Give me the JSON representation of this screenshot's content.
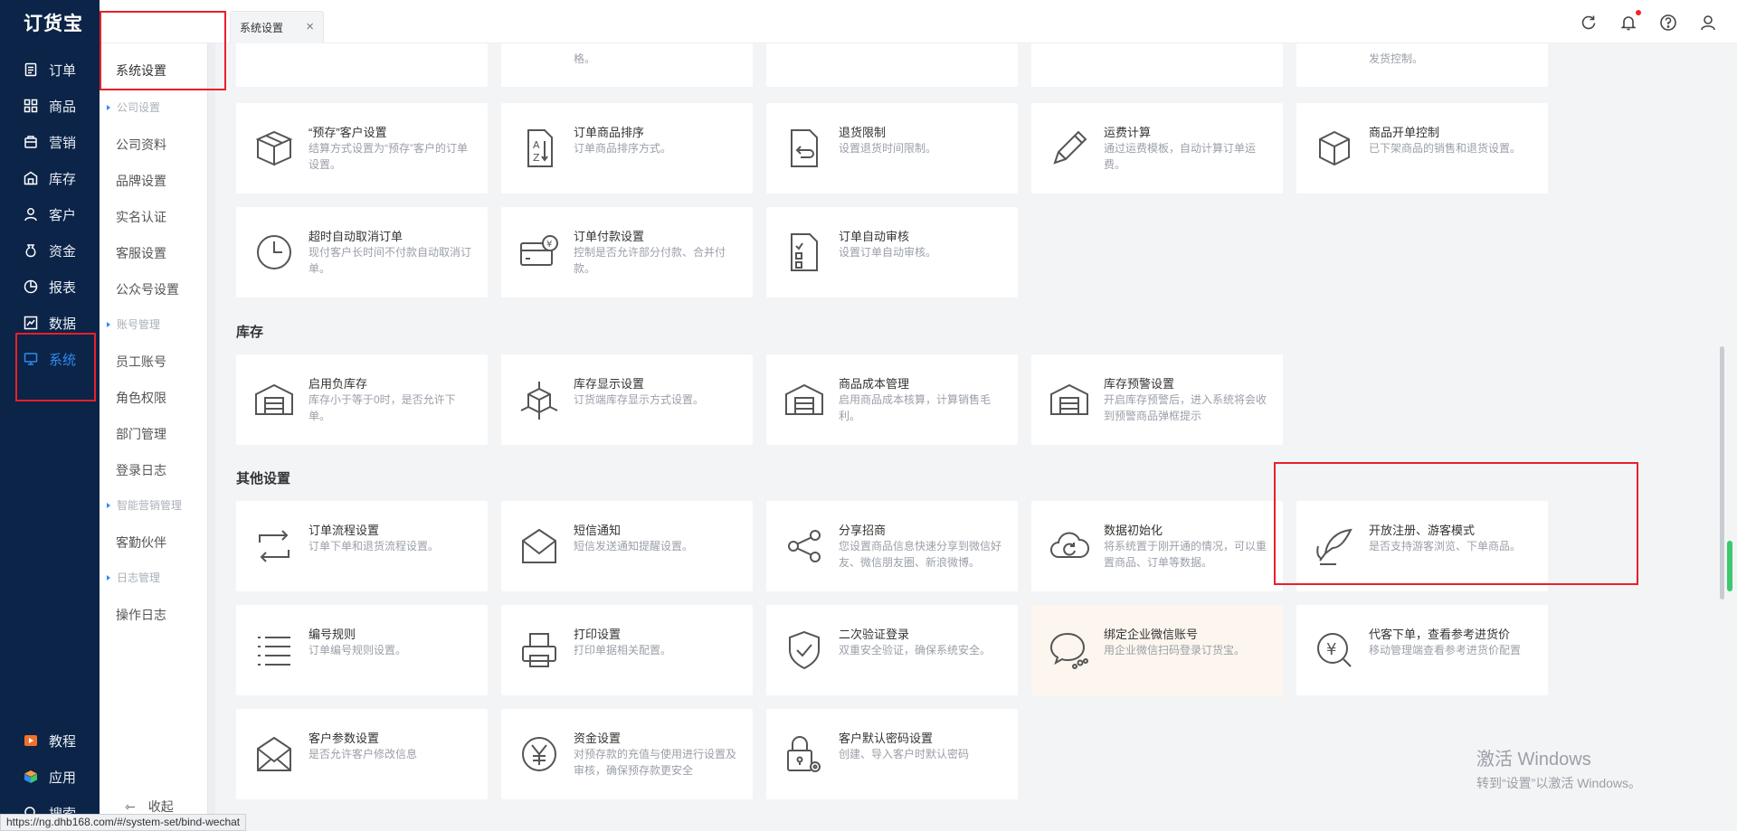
{
  "app": {
    "logo": "订货宝"
  },
  "nav": {
    "items": [
      {
        "label": "订单",
        "icon": "order-icon"
      },
      {
        "label": "商品",
        "icon": "goods-icon"
      },
      {
        "label": "营销",
        "icon": "marketing-icon"
      },
      {
        "label": "库存",
        "icon": "inventory-icon"
      },
      {
        "label": "客户",
        "icon": "customer-icon"
      },
      {
        "label": "资金",
        "icon": "funds-icon"
      },
      {
        "label": "报表",
        "icon": "report-icon"
      },
      {
        "label": "数据",
        "icon": "data-icon"
      },
      {
        "label": "系统",
        "icon": "system-icon",
        "active": true
      }
    ],
    "bottom": [
      {
        "label": "教程",
        "icon": "tutorial-icon"
      },
      {
        "label": "应用",
        "icon": "apps-icon"
      },
      {
        "label": "搜索",
        "icon": "search-icon"
      }
    ]
  },
  "submenu": {
    "title": "系统设置",
    "groups": [
      {
        "name": "公司设置",
        "items": [
          "公司资料",
          "品牌设置",
          "实名认证",
          "客服设置",
          "公众号设置"
        ]
      },
      {
        "name": "账号管理",
        "items": [
          "员工账号",
          "角色权限",
          "部门管理",
          "登录日志"
        ]
      },
      {
        "name": "智能营销管理",
        "items": [
          "客勤伙伴"
        ]
      },
      {
        "name": "日志管理",
        "items": [
          "操作日志"
        ]
      }
    ],
    "collapse_label": "收起"
  },
  "tabs": [
    {
      "label": "系统设置",
      "close": "×"
    }
  ],
  "header_icons": [
    "refresh-icon",
    "bell-icon",
    "help-icon",
    "user-icon"
  ],
  "top_partial": [
    {
      "desc": "格。"
    },
    {
      "desc": "发货控制。"
    }
  ],
  "order_cards": [
    {
      "title": "“预存”客户设置",
      "desc": "结算方式设置为“预存”客户的订单设置。",
      "icon": "box-open-icon"
    },
    {
      "title": "订单商品排序",
      "desc": "订单商品排序方式。",
      "icon": "sort-az-icon"
    },
    {
      "title": "退货限制",
      "desc": "设置退货时间限制。",
      "icon": "return-doc-icon"
    },
    {
      "title": "运费计算",
      "desc": "通过运费模板，自动计算订单运费。",
      "icon": "pencil-icon"
    },
    {
      "title": "商品开单控制",
      "desc": "已下架商品的销售和退货设置。",
      "icon": "cube-icon"
    },
    {
      "title": "超时自动取消订单",
      "desc": "现付客户长时间不付款自动取消订单。",
      "icon": "clock-icon"
    },
    {
      "title": "订单付款设置",
      "desc": "控制是否允许部分付款、合并付款。",
      "icon": "payment-card-icon"
    },
    {
      "title": "订单自动审核",
      "desc": "设置订单自动审核。",
      "icon": "checklist-icon"
    }
  ],
  "sections": {
    "inventory": "库存",
    "other": "其他设置"
  },
  "inventory_cards": [
    {
      "title": "启用负库存",
      "desc": "库存小于等于0时，是否允许下单。",
      "icon": "warehouse-icon"
    },
    {
      "title": "库存显示设置",
      "desc": "订货端库存显示方式设置。",
      "icon": "cube-pin-icon"
    },
    {
      "title": "商品成本管理",
      "desc": "启用商品成本核算，计算销售毛利。",
      "icon": "warehouse-icon"
    },
    {
      "title": "库存预警设置",
      "desc": "开启库存预警后，进入系统将会收到预警商品弹框提示",
      "icon": "warehouse-icon"
    }
  ],
  "other_cards": [
    {
      "title": "订单流程设置",
      "desc": "订单下单和退货流程设置。",
      "icon": "flow-arrows-icon"
    },
    {
      "title": "短信通知",
      "desc": "短信发送通知提醒设置。",
      "icon": "envelope-icon"
    },
    {
      "title": "分享招商",
      "desc": "您设置商品信息快速分享到微信好友、微信朋友圈、新浪微博。",
      "icon": "share-icon"
    },
    {
      "title": "数据初始化",
      "desc": "将系统置于刚开通的情况，可以重置商品、订单等数据。",
      "icon": "cloud-refresh-icon"
    },
    {
      "title": "开放注册、游客模式",
      "desc": "是否支持游客浏览、下单商品。",
      "icon": "feather-sign-icon"
    },
    {
      "title": "编号规则",
      "desc": "订单编号规则设置。",
      "icon": "list-icon"
    },
    {
      "title": "打印设置",
      "desc": "打印单据相关配置。",
      "icon": "printer-icon"
    },
    {
      "title": "二次验证登录",
      "desc": "双重安全验证，确保系统安全。",
      "icon": "shield-check-icon"
    },
    {
      "title": "绑定企业微信账号",
      "desc": "用企业微信扫码登录订货宝。",
      "icon": "wechat-work-icon",
      "highlight": true
    },
    {
      "title": "代客下单，查看参考进货价",
      "desc": "移动管理端查看参考进货价配置",
      "icon": "yen-search-icon"
    },
    {
      "title": "客户参数设置",
      "desc": "是否允许客户修改信息",
      "icon": "envelope-open-icon"
    },
    {
      "title": "资金设置",
      "desc": "对预存款的充值与使用进行设置及审核，确保预存款更安全",
      "icon": "yen-circle-icon"
    },
    {
      "title": "客户默认密码设置",
      "desc": "创建、导入客户时默认密码",
      "icon": "lock-gear-icon"
    }
  ],
  "status_url": "https://ng.dhb168.com/#/system-set/bind-wechat",
  "watermark": {
    "line1": "激活 Windows",
    "line2": "转到“设置”以激活 Windows。"
  }
}
